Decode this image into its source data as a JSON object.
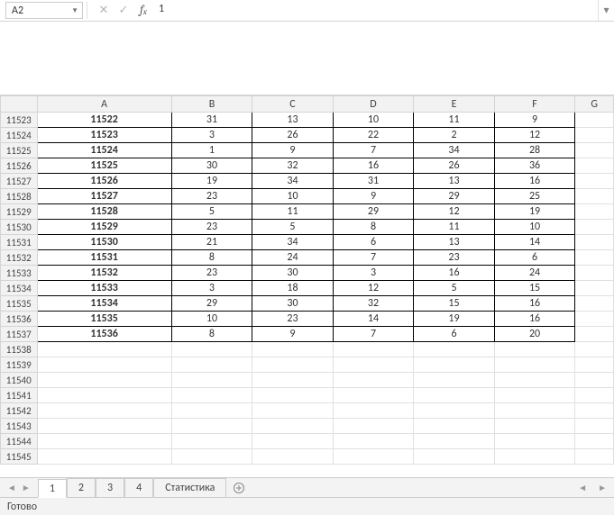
{
  "formula_bar": {
    "name_box": "A2",
    "formula": "1"
  },
  "grid": {
    "col_headers": [
      "A",
      "B",
      "C",
      "D",
      "E",
      "F",
      "G"
    ],
    "row_headers": [
      "11523",
      "11524",
      "11525",
      "11526",
      "11527",
      "11528",
      "11529",
      "11530",
      "11531",
      "11532",
      "11533",
      "11534",
      "11535",
      "11536",
      "11537",
      "11538",
      "11539",
      "11540",
      "11541",
      "11542",
      "11543",
      "11544",
      "11545"
    ],
    "data_rows": [
      {
        "A": "11522",
        "B": "31",
        "C": "13",
        "D": "10",
        "E": "11",
        "F": "9"
      },
      {
        "A": "11523",
        "B": "3",
        "C": "26",
        "D": "22",
        "E": "2",
        "F": "12"
      },
      {
        "A": "11524",
        "B": "1",
        "C": "9",
        "D": "7",
        "E": "34",
        "F": "28"
      },
      {
        "A": "11525",
        "B": "30",
        "C": "32",
        "D": "16",
        "E": "26",
        "F": "36"
      },
      {
        "A": "11526",
        "B": "19",
        "C": "34",
        "D": "31",
        "E": "13",
        "F": "16"
      },
      {
        "A": "11527",
        "B": "23",
        "C": "10",
        "D": "9",
        "E": "29",
        "F": "25"
      },
      {
        "A": "11528",
        "B": "5",
        "C": "11",
        "D": "29",
        "E": "12",
        "F": "19"
      },
      {
        "A": "11529",
        "B": "23",
        "C": "5",
        "D": "8",
        "E": "11",
        "F": "10"
      },
      {
        "A": "11530",
        "B": "21",
        "C": "34",
        "D": "6",
        "E": "13",
        "F": "14"
      },
      {
        "A": "11531",
        "B": "8",
        "C": "24",
        "D": "7",
        "E": "23",
        "F": "6"
      },
      {
        "A": "11532",
        "B": "23",
        "C": "30",
        "D": "3",
        "E": "16",
        "F": "24"
      },
      {
        "A": "11533",
        "B": "3",
        "C": "18",
        "D": "12",
        "E": "5",
        "F": "15"
      },
      {
        "A": "11534",
        "B": "29",
        "C": "30",
        "D": "32",
        "E": "15",
        "F": "16"
      },
      {
        "A": "11535",
        "B": "10",
        "C": "23",
        "D": "14",
        "E": "19",
        "F": "16"
      },
      {
        "A": "11536",
        "B": "8",
        "C": "9",
        "D": "7",
        "E": "6",
        "F": "20"
      }
    ],
    "blank_rows": 8
  },
  "tabs": {
    "items": [
      {
        "label": "1",
        "active": true
      },
      {
        "label": "2",
        "active": false
      },
      {
        "label": "3",
        "active": false
      },
      {
        "label": "4",
        "active": false
      },
      {
        "label": "Статистика",
        "active": false
      }
    ]
  },
  "status": {
    "text": "Готово"
  },
  "chart_data": {
    "type": "table",
    "columns": [
      "A",
      "B",
      "C",
      "D",
      "E",
      "F"
    ],
    "rows": [
      [
        "11522",
        31,
        13,
        10,
        11,
        9
      ],
      [
        "11523",
        3,
        26,
        22,
        2,
        12
      ],
      [
        "11524",
        1,
        9,
        7,
        34,
        28
      ],
      [
        "11525",
        30,
        32,
        16,
        26,
        36
      ],
      [
        "11526",
        19,
        34,
        31,
        13,
        16
      ],
      [
        "11527",
        23,
        10,
        9,
        29,
        25
      ],
      [
        "11528",
        5,
        11,
        29,
        12,
        19
      ],
      [
        "11529",
        23,
        5,
        8,
        11,
        10
      ],
      [
        "11530",
        21,
        34,
        6,
        13,
        14
      ],
      [
        "11531",
        8,
        24,
        7,
        23,
        6
      ],
      [
        "11532",
        23,
        30,
        3,
        16,
        24
      ],
      [
        "11533",
        3,
        18,
        12,
        5,
        15
      ],
      [
        "11534",
        29,
        30,
        32,
        15,
        16
      ],
      [
        "11535",
        10,
        23,
        14,
        19,
        16
      ],
      [
        "11536",
        8,
        9,
        7,
        6,
        20
      ]
    ]
  }
}
